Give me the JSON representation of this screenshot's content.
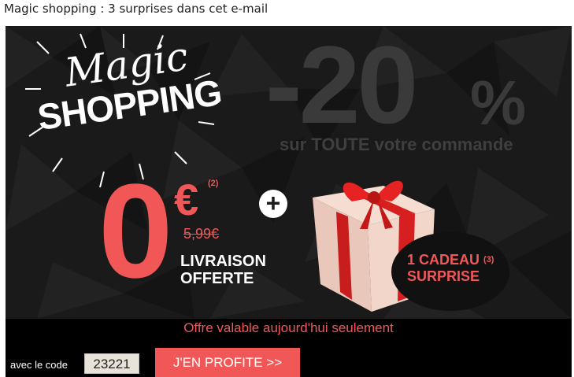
{
  "email": {
    "subject": "Magic shopping : 3 surprises dans cet e-mail"
  },
  "banner": {
    "magic_word": "Magic",
    "shopping_word": "SHOPPING",
    "discount": "-20",
    "discount_unit": "%",
    "discount_scope": "sur TOUTE votre commande",
    "shipping_price": "0",
    "currency": "€",
    "shipping_ref": "(2)",
    "old_shipping_price": "5,99€",
    "shipping_line1": "LIVRAISON",
    "shipping_line2": "OFFERTE",
    "plus_symbol": "+",
    "gift_line1": "1 CADEAU",
    "gift_ref": "(3)",
    "gift_line2": "SURPRISE",
    "colors": {
      "accent": "#f25757",
      "background": "#1a1a1a"
    }
  },
  "footer": {
    "validity": "Offre valable aujourd'hui seulement",
    "code_label": "avec le code",
    "code_value": "23221",
    "cta_label": "J'EN PROFITE >>"
  }
}
